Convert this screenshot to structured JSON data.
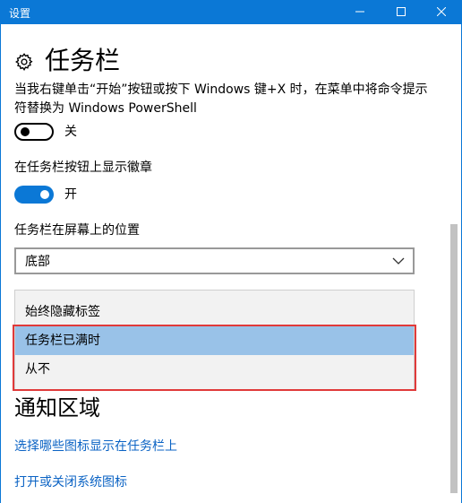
{
  "window": {
    "title": "设置",
    "controls": {
      "minimize": "minimize-icon",
      "maximize": "maximize-icon",
      "close": "close-icon"
    },
    "accent_color": "#0b78d6"
  },
  "page": {
    "icon": "gear-icon",
    "title": "任务栏"
  },
  "powershell": {
    "description": "当我右键单击“开始”按钮或按下 Windows 键+X 时，在菜单中将命令提示符替换为 Windows PowerShell",
    "state": "关",
    "on": false
  },
  "badges": {
    "label": "在任务栏按钮上显示徽章",
    "state": "开",
    "on": true
  },
  "position": {
    "label": "任务栏在屏幕上的位置",
    "value": "底部"
  },
  "combine_dropdown": {
    "options": [
      "始终隐藏标签",
      "任务栏已满时",
      "从不"
    ],
    "highlighted": "任务栏已满时",
    "highlight_color": "#99c2e8",
    "annotation_color": "#e03a3a"
  },
  "notification": {
    "title": "通知区域",
    "links": [
      "选择哪些图标显示在任务栏上",
      "打开或关闭系统图标"
    ],
    "link_color": "#0b63c4"
  }
}
